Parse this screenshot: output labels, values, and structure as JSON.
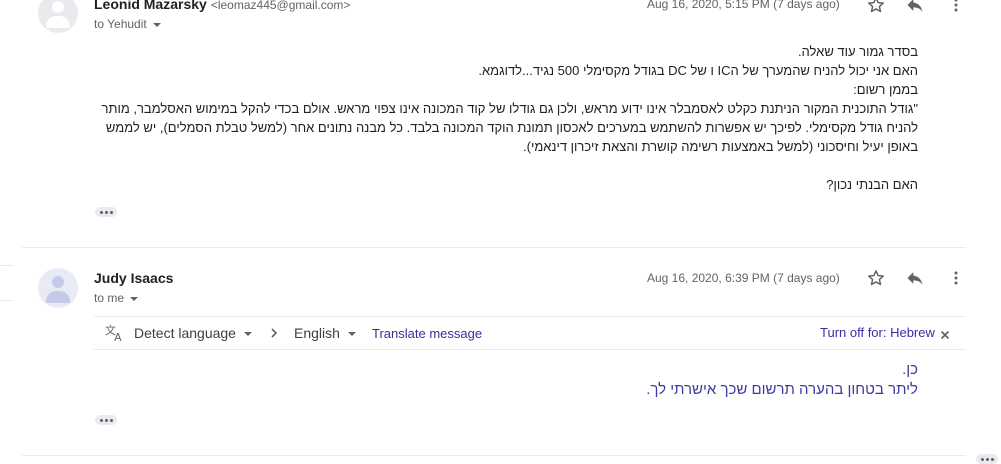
{
  "message1": {
    "sender_name": "Leonid Mazarsky",
    "sender_email": "<leomaz445@gmail.com>",
    "to_label": "to Yehudit",
    "date": "Aug 16, 2020, 5:15 PM (7 days ago)",
    "body": [
      "בסדר גמור עוד שאלה.",
      "האם אני יכול להניח שהמערך של הIC ו של DC בגודל מקסימלי 500 נגיד...לדוגמא.",
      "בממן רשום:",
      "\"גודל התוכנית המקור הניתנת כקלט לאסמבלר אינו ידוע מראש, ולכן גם גודלו של קוד המכונה אינו צפוי מראש. אולם בכדי להקל במימוש האסלמבר, מותר",
      "להניח גודל מקסימלי. לפיכך יש אפשרות להשתמש במערכים לאכסון תמונת הוקד המכונה בלבד. כל מבנה נתונים אחר (למשל טבלת הסמלים), יש לממש",
      "באופן יעיל וחיסכוני (למשל באמצעות רשימה קושרת והצאת זיכרון דינאמי).",
      "",
      "האם הבנתי נכון?"
    ]
  },
  "message2": {
    "sender_name": "Judy Isaacs",
    "to_label": "to me",
    "date": "Aug 16, 2020, 6:39 PM (7 days ago)",
    "translate_bar": {
      "detect_language": "Detect language",
      "target_language": "English",
      "translate_link": "Translate message",
      "turn_off": "Turn off for: Hebrew"
    },
    "body": [
      "כן.",
      "ליתר בטחון בהערה תרשום שכך אישרתי לך."
    ]
  },
  "colors": {
    "accent_link": "#4527a0",
    "reply_text": "#3c3aa3"
  },
  "icons": [
    "star-icon",
    "reply-icon",
    "more-vert-icon",
    "translate-icon",
    "chevron-right-icon",
    "close-icon",
    "person-icon"
  ]
}
